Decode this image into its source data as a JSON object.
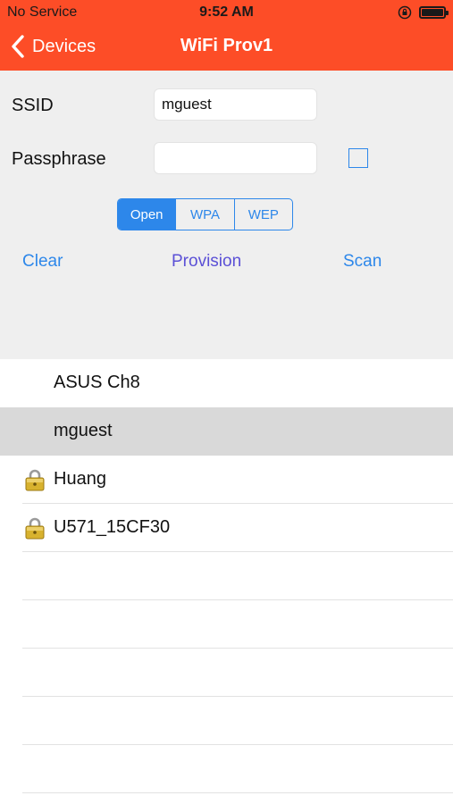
{
  "status_bar": {
    "carrier": "No Service",
    "time": "9:52 AM",
    "icons": [
      "orientation-lock-icon",
      "battery-icon"
    ]
  },
  "nav": {
    "back_label": "Devices",
    "title": "WiFi Prov1"
  },
  "form": {
    "ssid_label": "SSID",
    "ssid_value": "mguest",
    "passphrase_label": "Passphrase",
    "passphrase_value": "",
    "show_passphrase_checked": false,
    "security_options": [
      "Open",
      "WPA",
      "WEP"
    ],
    "security_selected": "Open",
    "clear_label": "Clear",
    "provision_label": "Provision",
    "scan_label": "Scan"
  },
  "networks": [
    {
      "name": "ASUS Ch8",
      "secured": false,
      "selected": false
    },
    {
      "name": "mguest",
      "secured": false,
      "selected": true
    },
    {
      "name": "Huang",
      "secured": true,
      "selected": false
    },
    {
      "name": "U571_15CF30",
      "secured": true,
      "selected": false
    }
  ],
  "colors": {
    "header_background": "#fd4d27",
    "accent_blue": "#2d87ea",
    "provision_color": "#5b50d6",
    "form_background": "#efefef",
    "selected_row": "#d9d9d9"
  }
}
